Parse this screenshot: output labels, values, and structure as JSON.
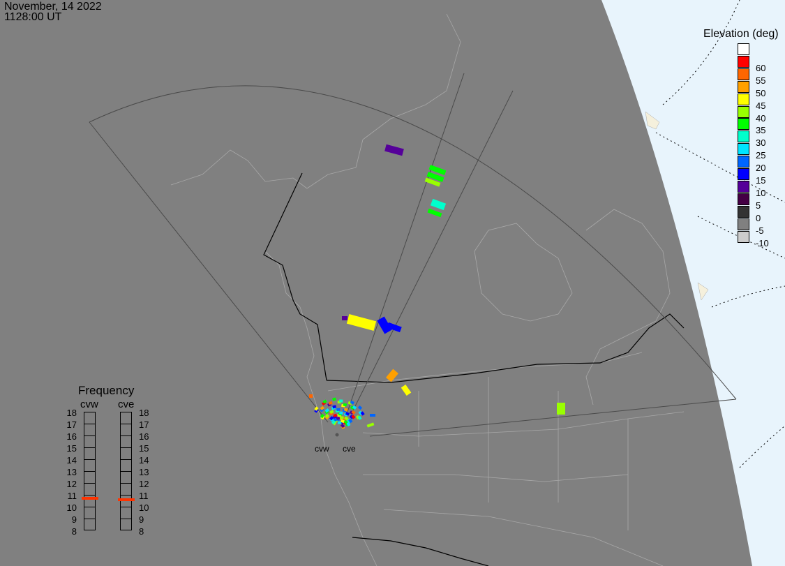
{
  "header": {
    "date": "November, 14 2022",
    "time": "1128:00 UT"
  },
  "legend": {
    "title": "Elevation (deg)",
    "cells": [
      {
        "color": "#ffffff",
        "label": ""
      },
      {
        "color": "#ff0000",
        "label": "60"
      },
      {
        "color": "#ff6600",
        "label": "55"
      },
      {
        "color": "#ffa000",
        "label": "50"
      },
      {
        "color": "#ffff00",
        "label": "45"
      },
      {
        "color": "#99ff00",
        "label": "40"
      },
      {
        "color": "#00ff00",
        "label": "35"
      },
      {
        "color": "#00ffcc",
        "label": "30"
      },
      {
        "color": "#00e5ff",
        "label": "25"
      },
      {
        "color": "#0066ff",
        "label": "20"
      },
      {
        "color": "#0000ff",
        "label": "15"
      },
      {
        "color": "#550099",
        "label": "10"
      },
      {
        "color": "#440044",
        "label": "5"
      },
      {
        "color": "#333333",
        "label": "0"
      },
      {
        "color": "#808080",
        "label": "-5"
      },
      {
        "color": "#cccccc",
        "label": "-10"
      }
    ]
  },
  "frequency": {
    "title": "Frequency",
    "radars": [
      {
        "name": "cvw",
        "value_mhz": 10.7
      },
      {
        "name": "cve",
        "value_mhz": 10.6
      }
    ],
    "ticks": [
      "18",
      "17",
      "16",
      "15",
      "14",
      "13",
      "12",
      "11",
      "10",
      "9",
      "8"
    ],
    "marker_color": "#ff3300"
  },
  "sites": {
    "cvw": "cvw",
    "cve": "cve"
  },
  "colors": {
    "background": "#808080",
    "space": "#e8f4fc"
  }
}
